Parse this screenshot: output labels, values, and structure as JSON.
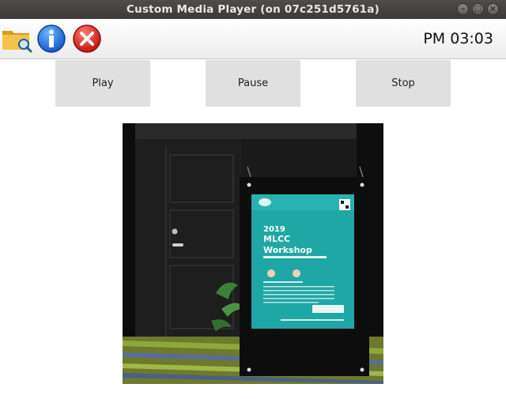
{
  "window": {
    "title": "Custom Media Player (on 07c251d5761a)",
    "controls": [
      "minimize-icon",
      "maximize-icon",
      "close-icon"
    ]
  },
  "toolbar": {
    "icons": [
      "folder-search-icon",
      "info-icon",
      "exit-icon"
    ],
    "clock": "PM 03:03"
  },
  "controls": {
    "play_label": "Play",
    "pause_label": "Pause",
    "stop_label": "Stop"
  },
  "video": {
    "poster": {
      "year": "2019",
      "line1": "MLCC",
      "line2": "Workshop"
    }
  },
  "colors": {
    "titlebar": "#3e3d39",
    "button_bg": "#e0e0e0",
    "poster_teal": "#1fa7a5"
  }
}
